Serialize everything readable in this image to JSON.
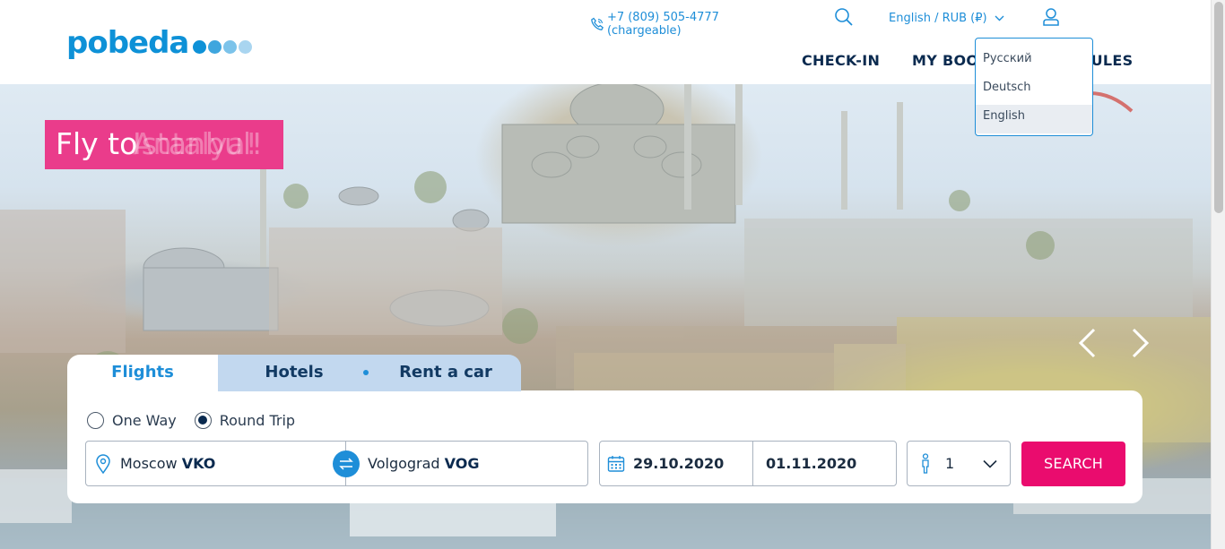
{
  "brand": {
    "logo_text": "pobeda",
    "primary_color": "#0e91d7",
    "accent_color": "#ea0c6e",
    "dot_colors": [
      "#0e91d7",
      "#3fa6de",
      "#7cc3ea",
      "#a9d5f0"
    ]
  },
  "header": {
    "phone": "+7 (809) 505-4777 (chargeable)",
    "language_selector": "English / RUB (₽)",
    "nav": {
      "checkin": "CHECK-IN",
      "booking": "MY BOOKING",
      "rules": "RULES"
    }
  },
  "language_dropdown": {
    "options": [
      "Русский",
      "Deutsch",
      "English"
    ],
    "selected": "English"
  },
  "hero": {
    "promo_prefix": "Fly to ",
    "promo_city_ghost": "Antalya!",
    "promo_city": "Istanbul!"
  },
  "tabs": {
    "flights": "Flights",
    "hotels": "Hotels",
    "car": "Rent a car"
  },
  "search": {
    "trip_types": {
      "one_way": "One Way",
      "round_trip": "Round Trip",
      "selected": "Round Trip"
    },
    "from_city": "Moscow",
    "from_code": "VKO",
    "to_city": "Volgograd",
    "to_code": "VOG",
    "depart_date": "29.10.2020",
    "return_date": "01.11.2020",
    "passengers": "1",
    "search_button": "SEARCH"
  }
}
